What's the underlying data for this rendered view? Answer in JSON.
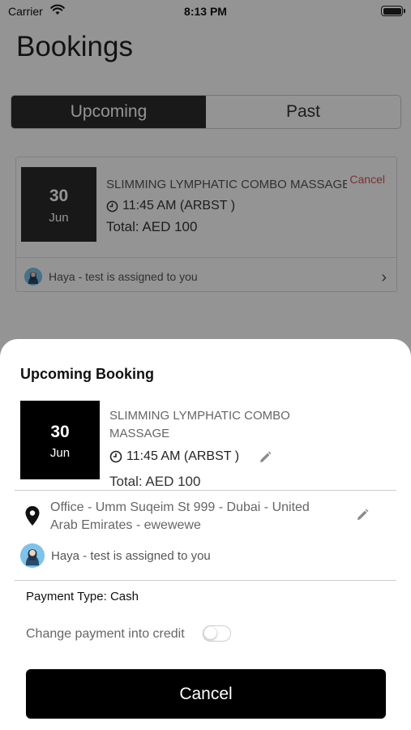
{
  "status_bar": {
    "carrier": "Carrier",
    "time": "8:13 PM"
  },
  "page": {
    "title": "Bookings"
  },
  "tabs": [
    {
      "label": "Upcoming",
      "active": true
    },
    {
      "label": "Past",
      "active": false
    }
  ],
  "background_booking": {
    "day": "30",
    "month": "Jun",
    "service": "SLIMMING LYMPHATIC COMBO MASSAGE",
    "cancel_label": "Cancel",
    "time": "11:45 AM (ARBST )",
    "total": "Total: AED 100",
    "assigned": "Haya - test is assigned to you"
  },
  "sheet": {
    "title": "Upcoming Booking",
    "day": "30",
    "month": "Jun",
    "service": "SLIMMING LYMPHATIC COMBO MASSAGE",
    "time": "11:45 AM (ARBST )",
    "total": "Total: AED 100",
    "address": "Office - Umm Suqeim St 999 - Dubai - United Arab Emirates - ewewewe",
    "assigned": "Haya - test is assigned to you",
    "payment_type": "Payment Type: Cash",
    "credit_label": "Change payment into credit",
    "credit_toggle_on": false,
    "cancel_button": "Cancel"
  },
  "colors": {
    "accent_dark": "#2b2b2b",
    "cancel_red": "#d9534f",
    "avatar_blue": "#7fc3e8"
  },
  "icons": [
    "wifi-icon",
    "battery-icon",
    "clock-icon",
    "chevron-right-icon",
    "edit-pencil-icon",
    "location-pin-icon",
    "avatar"
  ]
}
